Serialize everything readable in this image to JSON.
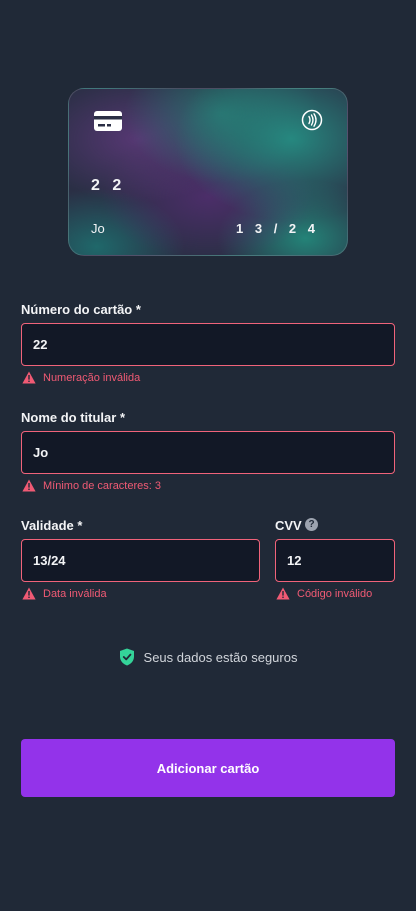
{
  "card_preview": {
    "number": "2 2",
    "holder": "Jo",
    "expiry": "1 3 / 2 4",
    "chip_icon": "credit-card-icon",
    "contactless_icon": "contactless-icon"
  },
  "form": {
    "card_number": {
      "label": "Número do cartão *",
      "value": "22",
      "error": "Numeração inválida"
    },
    "holder_name": {
      "label": "Nome do titular *",
      "value": "Jo",
      "error": "Mínimo de caracteres: 3"
    },
    "expiry": {
      "label": "Validade *",
      "value": "13/24",
      "error": "Data inválida"
    },
    "cvv": {
      "label": "CVV",
      "help_icon": "help-circle-icon",
      "help_glyph": "?",
      "value": "12",
      "error": "Código inválido"
    }
  },
  "security": {
    "icon": "shield-check-icon",
    "text": "Seus dados estão seguros"
  },
  "submit": {
    "label": "Adicionar cartão"
  },
  "colors": {
    "background": "#202937",
    "input_background": "#121826",
    "error": "#f05a74",
    "accent": "#9333ea",
    "shield": "#34d399"
  }
}
